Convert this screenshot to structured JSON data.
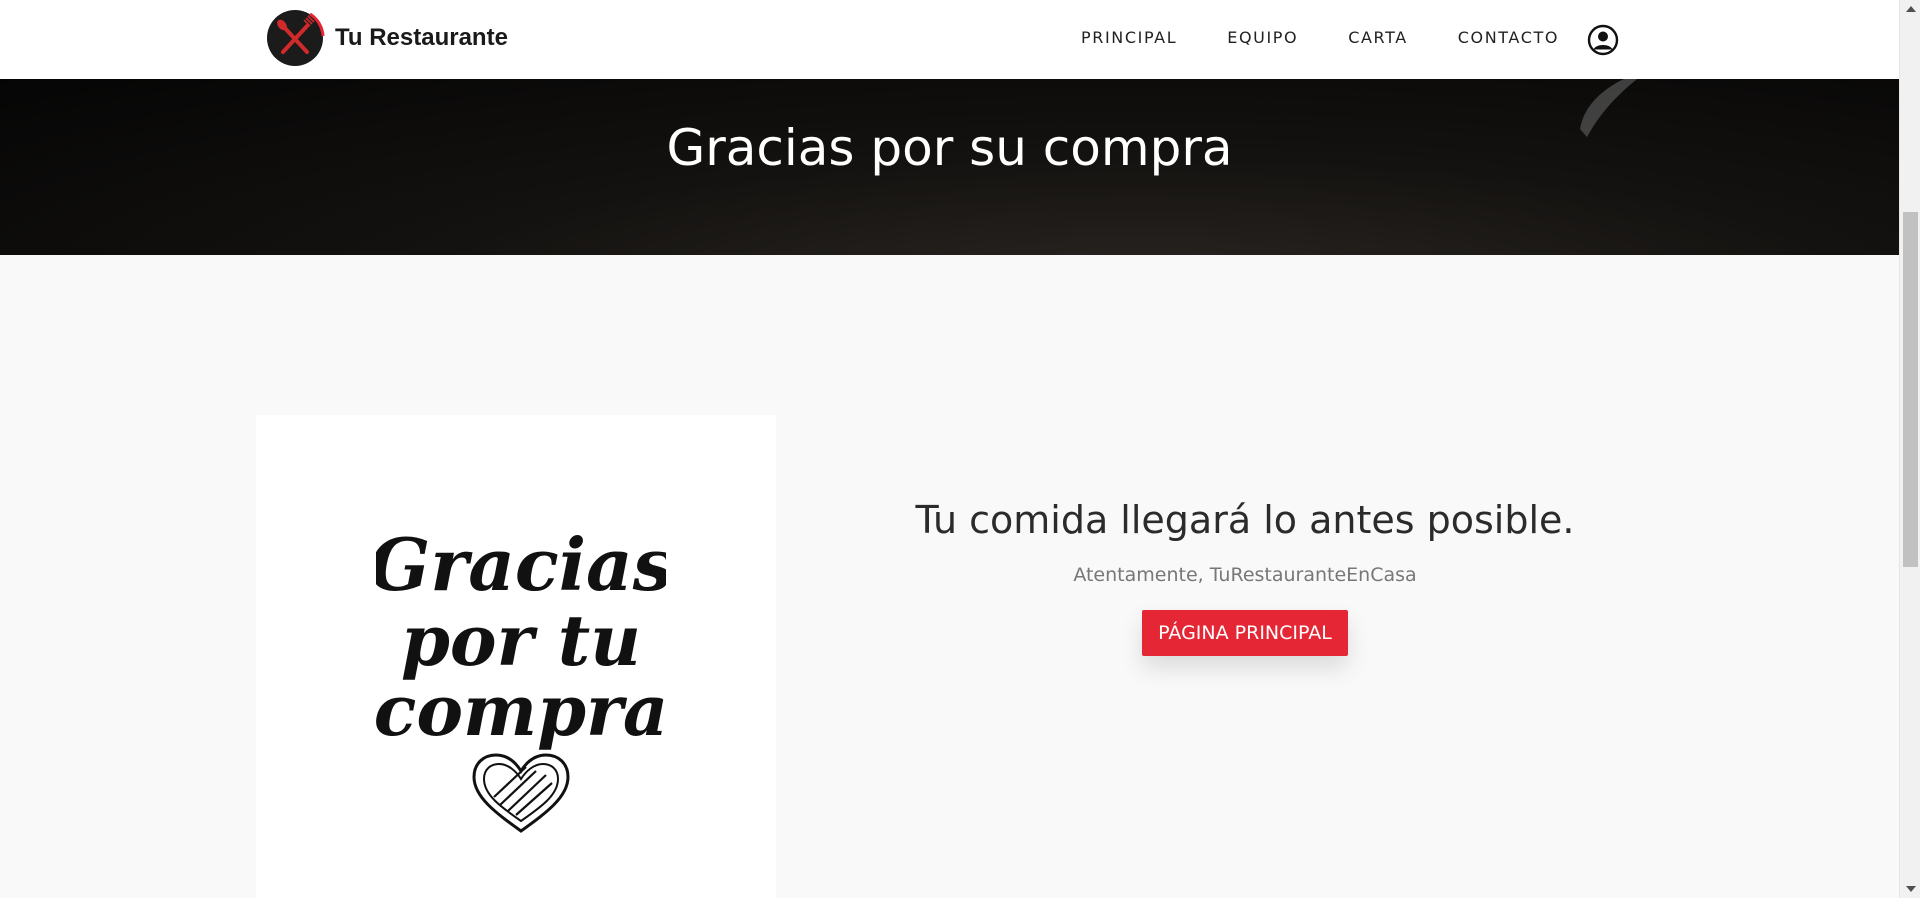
{
  "brand": {
    "name": "Tu Restaurante",
    "logo_icon": "fork-knife-cross-logo"
  },
  "nav": {
    "items": [
      {
        "label": "PRINCIPAL"
      },
      {
        "label": "EQUIPO"
      },
      {
        "label": "CARTA"
      },
      {
        "label": "CONTACTO"
      }
    ],
    "user_icon": "user-circle-icon"
  },
  "hero": {
    "title": "Gracias por su compra"
  },
  "image": {
    "lines": [
      "Gracias",
      "por tu",
      "compra"
    ],
    "icon": "heart-icon"
  },
  "message": {
    "title": "Tu comida llegará lo antes posible.",
    "signature": "Atentamente, TuRestauranteEnCasa",
    "button_label": "PÁGINA PRINCIPAL"
  },
  "colors": {
    "accent": "#e52735",
    "hero_bg": "#0a0a0a",
    "page_bg": "#f9f9f9"
  }
}
